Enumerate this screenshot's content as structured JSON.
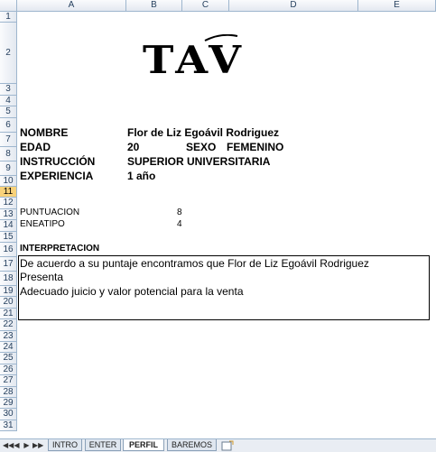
{
  "columns": [
    "A",
    "B",
    "C",
    "D",
    "E"
  ],
  "rows": [
    "1",
    "2",
    "3",
    "4",
    "5",
    "6",
    "7",
    "8",
    "9",
    "10",
    "11",
    "12",
    "13",
    "14",
    "15",
    "16",
    "17",
    "18",
    "19",
    "20",
    "21",
    "22",
    "23",
    "24",
    "25",
    "26",
    "27",
    "28",
    "29",
    "30",
    "31"
  ],
  "logo_text": "TAV",
  "profile": {
    "nombre_label": "NOMBRE",
    "nombre_value": "Flor de Liz Egoávil Rodriguez",
    "edad_label": "EDAD",
    "edad_value": "20",
    "sexo_label": "SEXO",
    "sexo_value": "FEMENINO",
    "instruccion_label": "INSTRUCCIÓN",
    "instruccion_value": "SUPERIOR UNIVERSITARIA",
    "experiencia_label": "EXPERIENCIA",
    "experiencia_value": "1 año"
  },
  "scores": {
    "puntuacion_label": "PUNTUACION",
    "puntuacion_value": "8",
    "eneatipo_label": "ENEATIPO",
    "eneatipo_value": "4"
  },
  "interpretation": {
    "heading": "INTERPRETACION",
    "line1": "De acuerdo a su puntaje encontramos que   Flor de Liz Egoávil Rodriguez",
    "line2": "Presenta",
    "line3": "Adecuado juicio y valor potencial para la venta"
  },
  "tabs": [
    "INTRO",
    "ENTER",
    "PERFIL",
    "BAREMOS"
  ],
  "active_tab": "PERFIL",
  "nav_buttons": [
    "◀◀",
    "◀",
    "▶",
    "▶▶"
  ]
}
